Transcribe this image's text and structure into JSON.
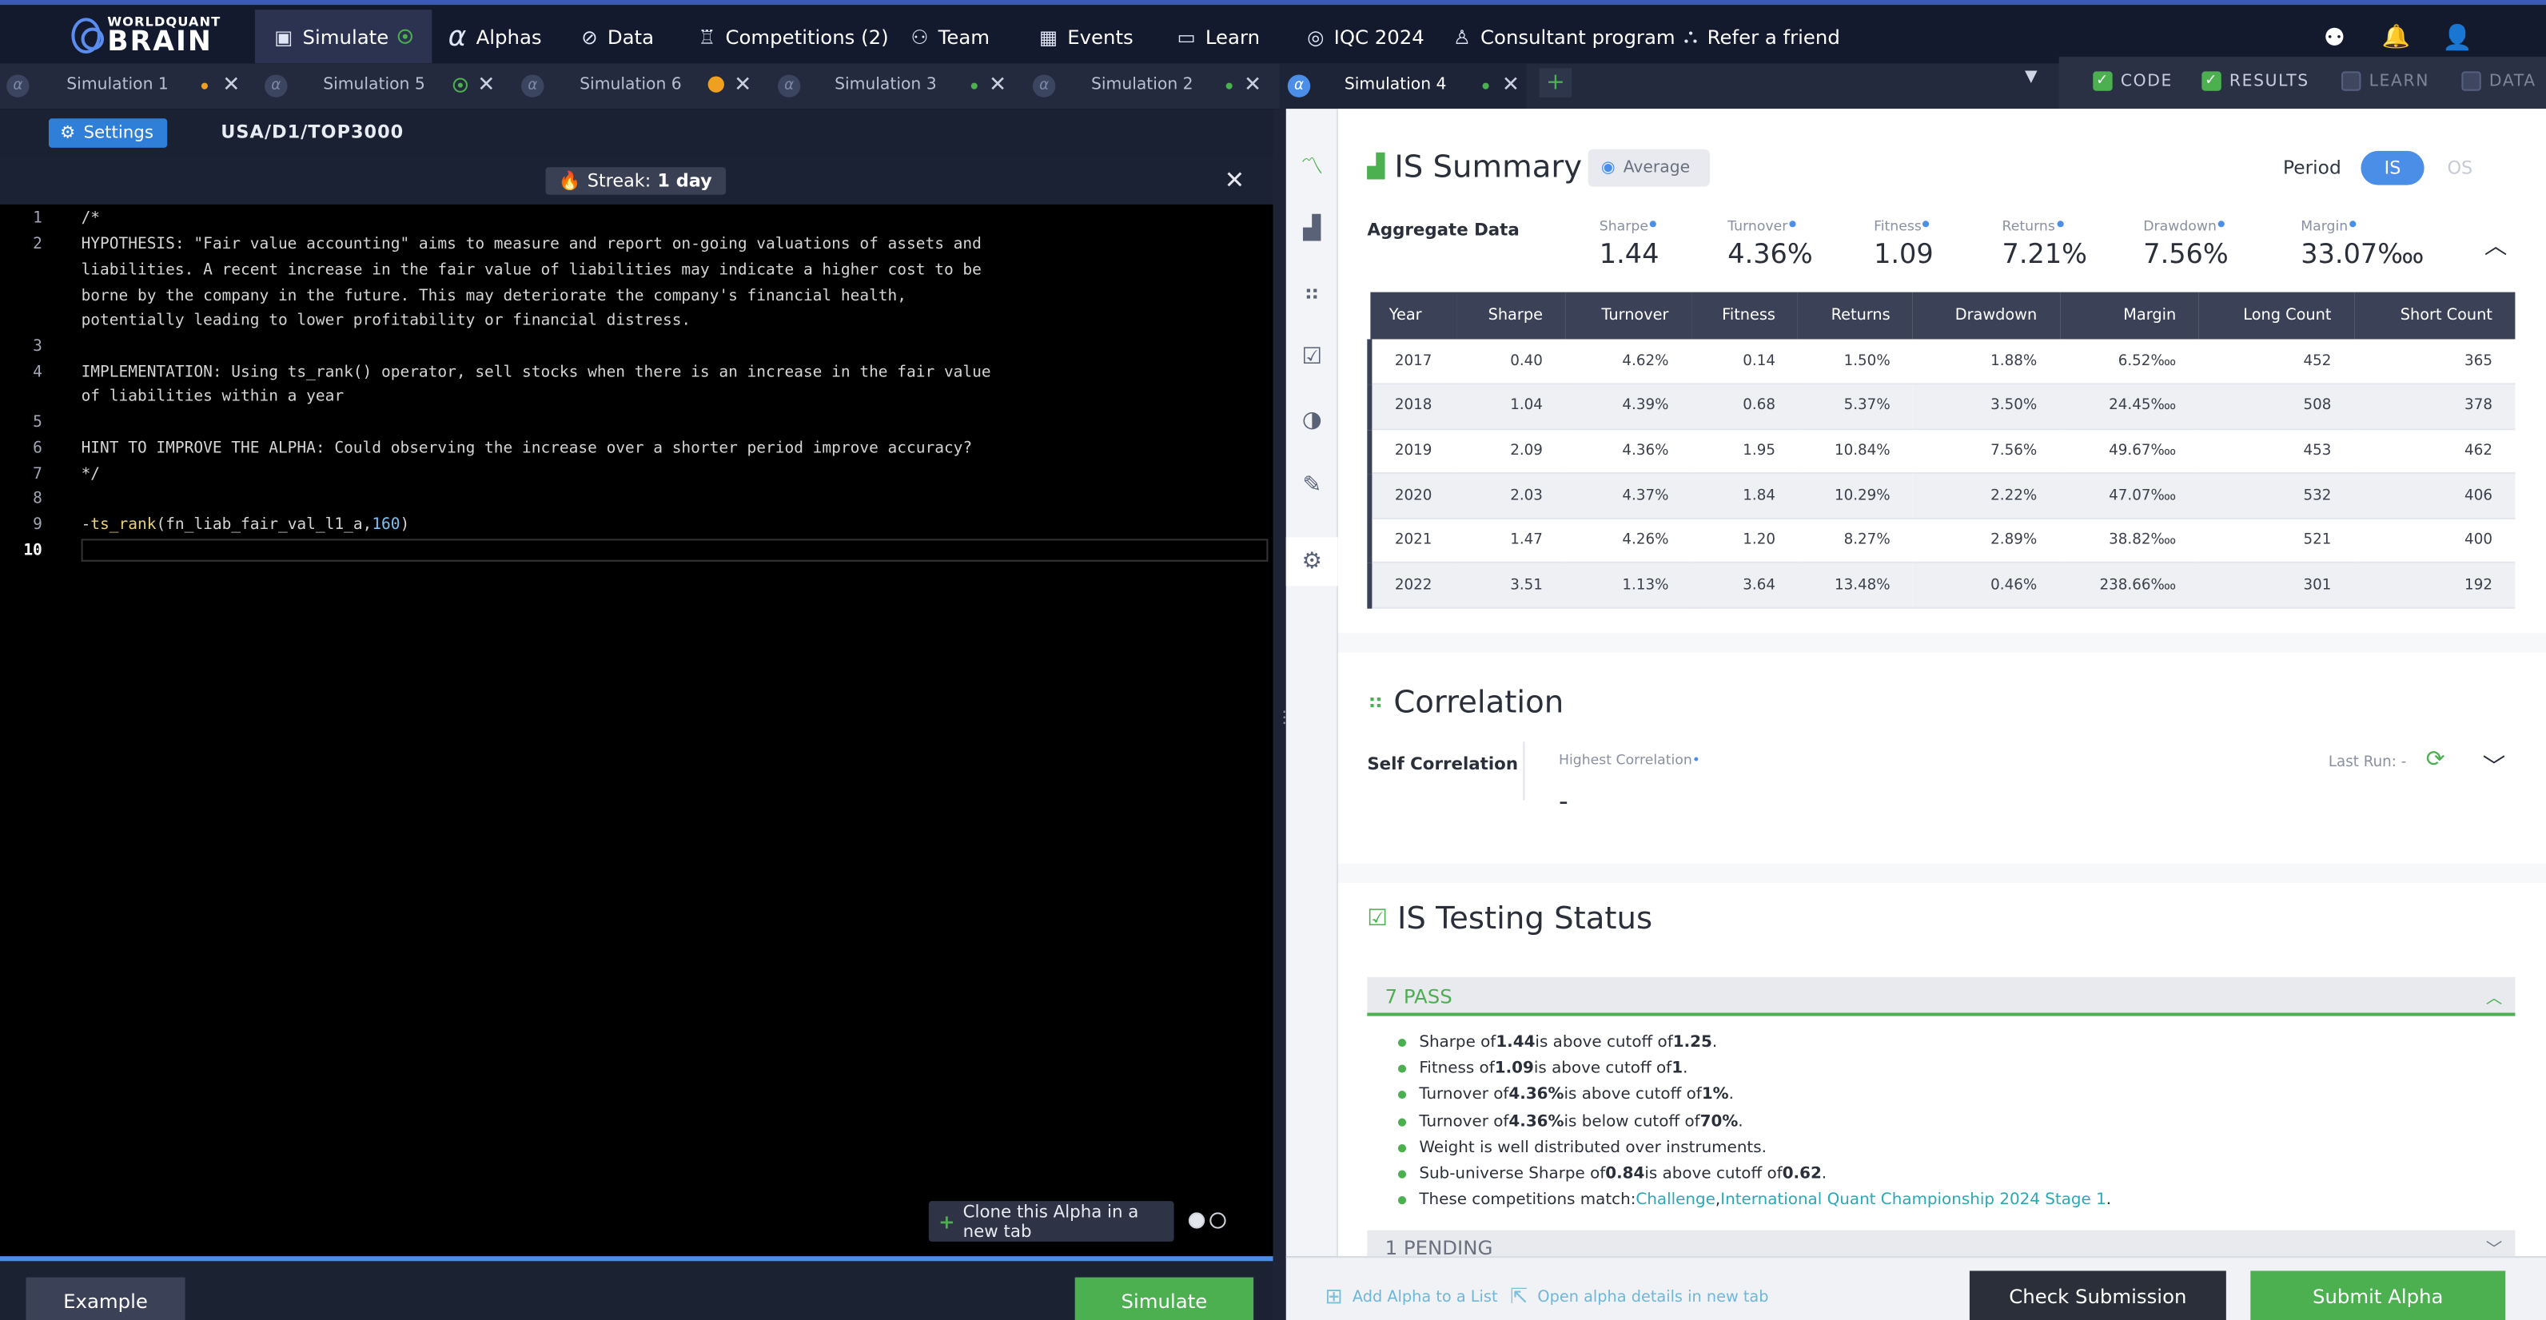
{
  "logo": {
    "line1": "WORLDQUANT",
    "line2": "BRAIN"
  },
  "nav": {
    "simulate": "Simulate",
    "alphas": "Alphas",
    "data": "Data",
    "competitions": "Competitions (2)",
    "team": "Team",
    "events": "Events",
    "learn": "Learn",
    "iqc": "IQC 2024",
    "consultant": "Consultant program",
    "refer": "Refer a friend"
  },
  "tabs": [
    {
      "label": "Simulation 1",
      "status_color": "#f0a020"
    },
    {
      "label": "Simulation 5",
      "status_color": "#4caf50"
    },
    {
      "label": "Simulation 6",
      "status_color": "#f0a020"
    },
    {
      "label": "Simulation 3",
      "status_color": "#4caf50"
    },
    {
      "label": "Simulation 2",
      "status_color": "#4caf50"
    },
    {
      "label": "Simulation 4",
      "status_color": "#4caf50"
    }
  ],
  "view_toggles": {
    "code": "CODE",
    "results": "RESULTS",
    "learn": "LEARN",
    "data": "DATA"
  },
  "settings": {
    "button": "Settings",
    "universe": "USA/D1/TOP3000"
  },
  "streak": {
    "prefix": "Streak: ",
    "value": "1 day"
  },
  "editor": {
    "line_numbers": [
      "1",
      "2",
      "",
      "",
      "",
      "3",
      "4",
      "",
      "5",
      "6",
      "7",
      "8",
      "9",
      "10"
    ],
    "lines": [
      "/*",
      "HYPOTHESIS: \"Fair value accounting\" aims to measure and report on-going valuations of assets and",
      "liabilities. A recent increase in the fair value of liabilities may indicate a higher cost to be",
      "borne by the company in the future. This may deteriorate the company's financial health,",
      "potentially leading to lower profitability or financial distress.",
      "",
      "IMPLEMENTATION: Using ts_rank() operator, sell stocks when there is an increase in the fair value",
      "of liabilities within a year",
      "",
      "HINT TO IMPROVE THE ALPHA: Could observing the increase over a shorter period improve accuracy?",
      "*/",
      ""
    ],
    "expr_prefix": "-",
    "expr_fn": "ts_rank",
    "expr_field": "(fn_liab_fair_val_l1_a,",
    "expr_num": "160",
    "expr_close": ")"
  },
  "clone_button": "Clone this Alpha in a new tab",
  "bottom_left": {
    "example": "Example",
    "simulate": "Simulate"
  },
  "summary": {
    "title": "IS Summary",
    "avg": "Average",
    "period_label": "Period",
    "period_is": "IS",
    "period_os": "OS",
    "aggregate_title": "Aggregate Data",
    "metrics": [
      {
        "label": "Sharpe",
        "value": "1.44"
      },
      {
        "label": "Turnover",
        "value": "4.36%"
      },
      {
        "label": "Fitness",
        "value": "1.09"
      },
      {
        "label": "Returns",
        "value": "7.21%"
      },
      {
        "label": "Drawdown",
        "value": "7.56%"
      },
      {
        "label": "Margin",
        "value": "33.07‱"
      }
    ]
  },
  "perf_table": {
    "headers": [
      "Year",
      "Sharpe",
      "Turnover",
      "Fitness",
      "Returns",
      "Drawdown",
      "Margin",
      "Long Count",
      "Short Count"
    ],
    "rows": [
      [
        "2017",
        "0.40",
        "4.62%",
        "0.14",
        "1.50%",
        "1.88%",
        "6.52‱",
        "452",
        "365"
      ],
      [
        "2018",
        "1.04",
        "4.39%",
        "0.68",
        "5.37%",
        "3.50%",
        "24.45‱",
        "508",
        "378"
      ],
      [
        "2019",
        "2.09",
        "4.36%",
        "1.95",
        "10.84%",
        "7.56%",
        "49.67‱",
        "453",
        "462"
      ],
      [
        "2020",
        "2.03",
        "4.37%",
        "1.84",
        "10.29%",
        "2.22%",
        "47.07‱",
        "532",
        "406"
      ],
      [
        "2021",
        "1.47",
        "4.26%",
        "1.20",
        "8.27%",
        "2.89%",
        "38.82‱",
        "521",
        "400"
      ],
      [
        "2022",
        "3.51",
        "1.13%",
        "3.64",
        "13.48%",
        "0.46%",
        "238.66‱",
        "301",
        "192"
      ]
    ]
  },
  "correlation": {
    "title": "Correlation",
    "self": "Self Correlation",
    "highest": "Highest Correlation",
    "value": "-",
    "last_run": "Last Run: -"
  },
  "testing": {
    "title": "IS Testing Status",
    "pass_label": "7 PASS",
    "pending_label": "1 PENDING",
    "checks": [
      {
        "a": "Sharpe of ",
        "b": "1.44",
        "c": " is above cutoff of ",
        "d": "1.25",
        "e": "."
      },
      {
        "a": "Fitness of ",
        "b": "1.09",
        "c": " is above cutoff of ",
        "d": "1",
        "e": "."
      },
      {
        "a": "Turnover of ",
        "b": "4.36%",
        "c": " is above cutoff of ",
        "d": "1%",
        "e": "."
      },
      {
        "a": "Turnover of ",
        "b": "4.36%",
        "c": " is below cutoff of ",
        "d": "70%",
        "e": "."
      },
      {
        "a": "Weight is well distributed over instruments.",
        "b": "",
        "c": "",
        "d": "",
        "e": ""
      },
      {
        "a": "Sub-universe Sharpe of ",
        "b": "0.84",
        "c": " is above cutoff of ",
        "d": "0.62",
        "e": "."
      }
    ],
    "competitions_prefix": "These competitions match: ",
    "comp1": "Challenge",
    "comp_sep": ", ",
    "comp2": "International Quant Championship 2024 Stage 1",
    "comp_end": "."
  },
  "bottom_right": {
    "add_list": "Add Alpha to a List",
    "open_details": "Open alpha details in new tab",
    "check_submission": "Check Submission",
    "submit_alpha": "Submit Alpha"
  }
}
